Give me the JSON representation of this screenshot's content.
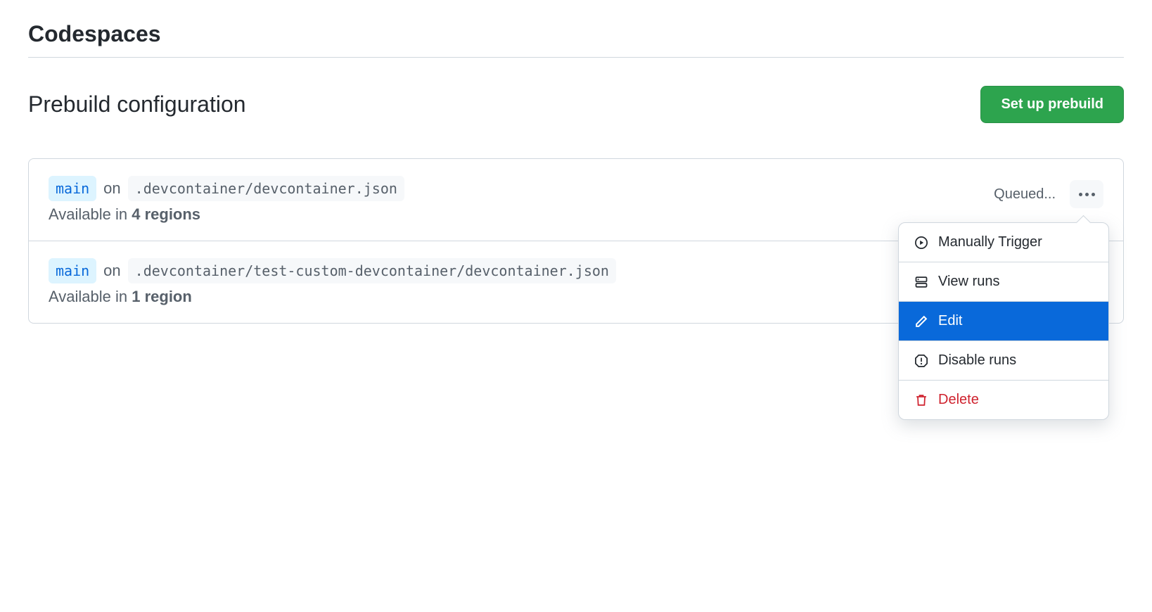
{
  "page": {
    "title": "Codespaces"
  },
  "section": {
    "title": "Prebuild configuration",
    "setup_button": "Set up prebuild"
  },
  "configs": [
    {
      "branch": "main",
      "on": "on",
      "path": ".devcontainer/devcontainer.json",
      "availability_prefix": "Available in ",
      "availability_count": "4 regions",
      "status": "Queued..."
    },
    {
      "branch": "main",
      "on": "on",
      "path": ".devcontainer/test-custom-devcontainer/devcontainer.json",
      "availability_prefix": "Available in ",
      "availability_count": "1 region"
    }
  ],
  "menu": {
    "manually_trigger": "Manually Trigger",
    "view_runs": "View runs",
    "edit": "Edit",
    "disable_runs": "Disable runs",
    "delete": "Delete"
  }
}
